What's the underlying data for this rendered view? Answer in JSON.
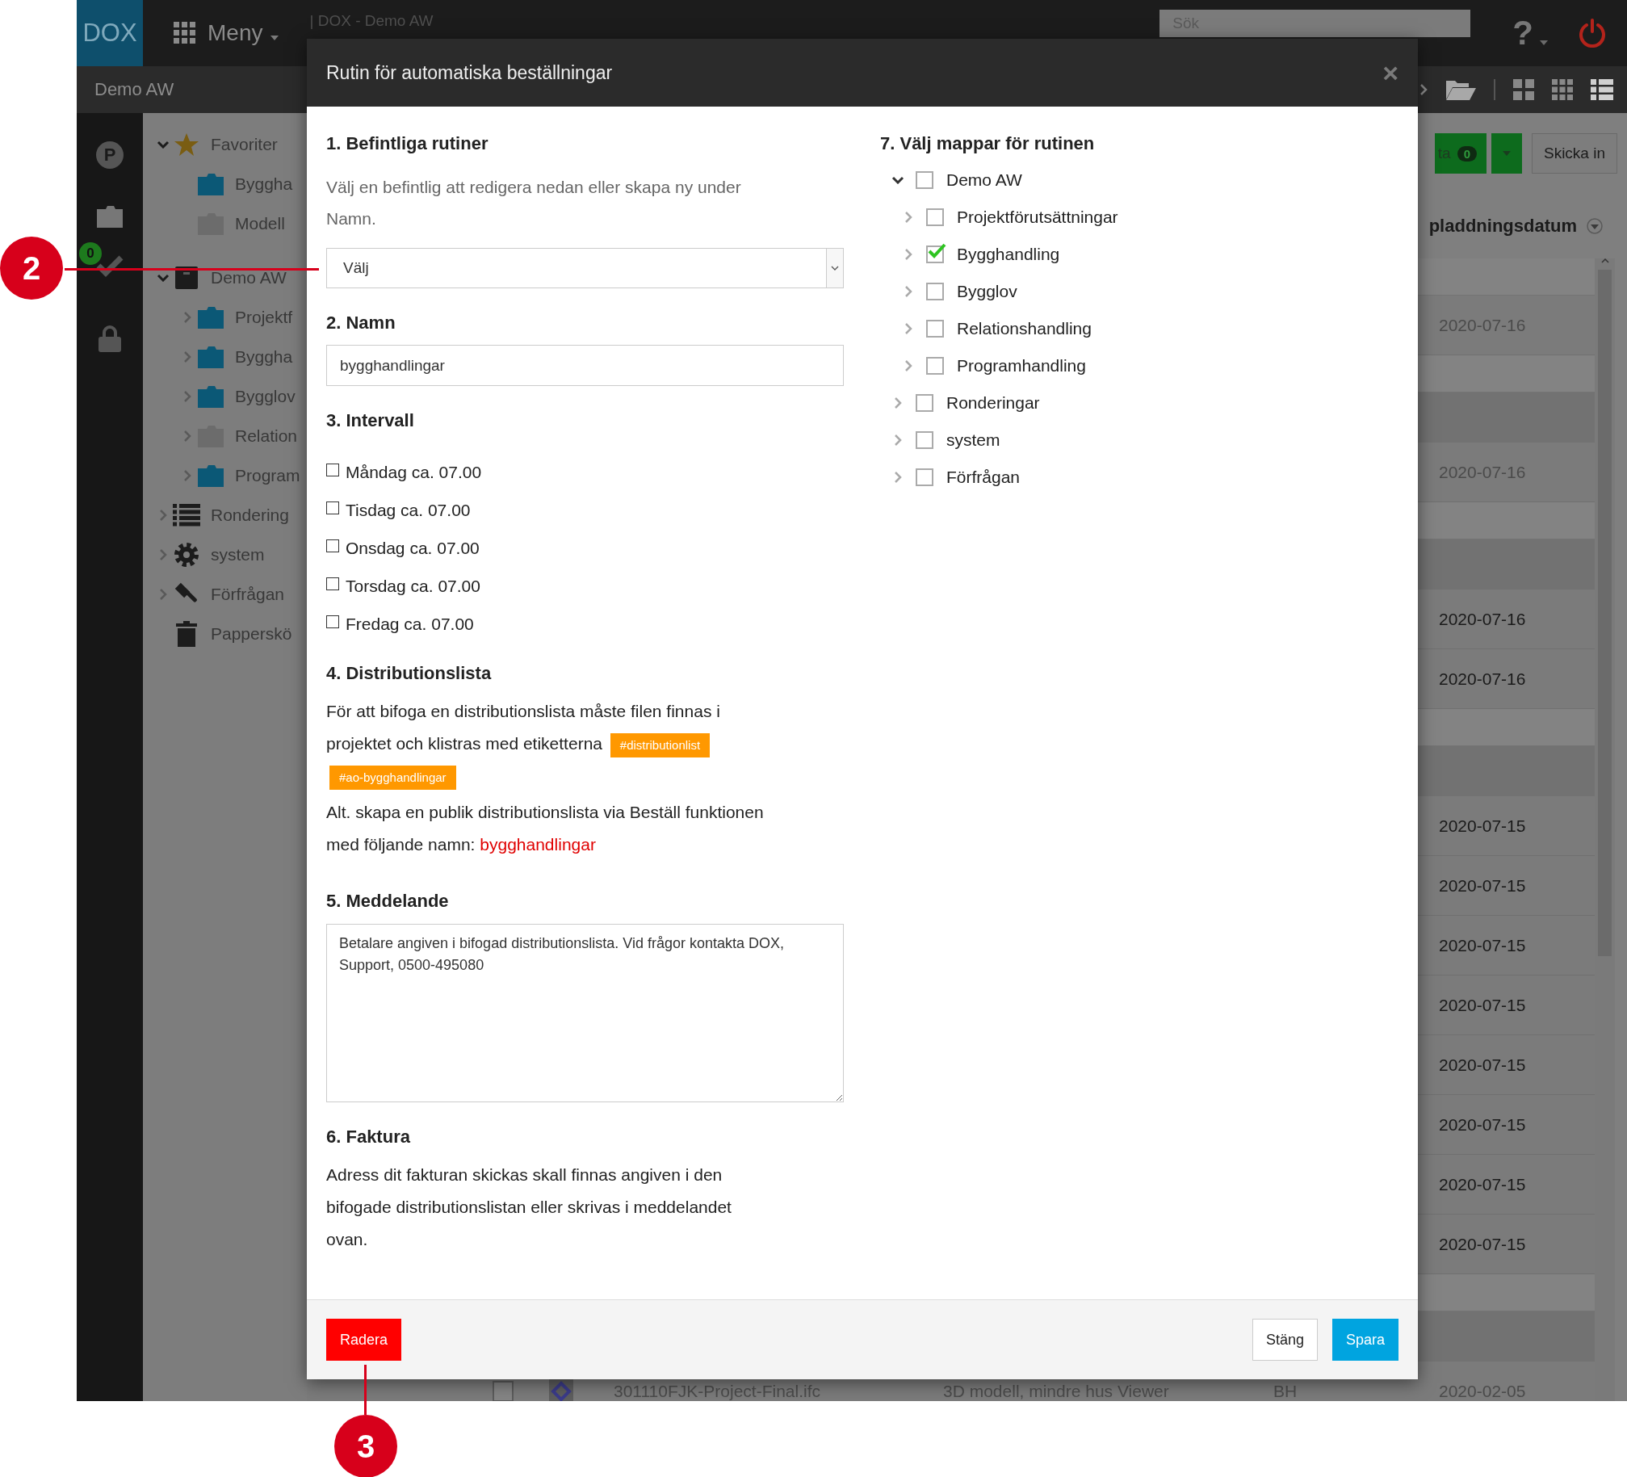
{
  "topbar": {
    "logo": "DOX",
    "menu": "Meny",
    "breadcrumb": "| DOX - Demo AW",
    "search": {
      "placeholder": "Sök"
    },
    "help": "?"
  },
  "subbar": {
    "title": "Demo AW"
  },
  "rail": {
    "items": [
      {
        "kind": "parking",
        "label": "P"
      },
      {
        "kind": "folder"
      },
      {
        "kind": "tasks",
        "badge": "0"
      },
      {
        "kind": "lock"
      }
    ]
  },
  "sidebar": {
    "items": [
      {
        "kind": "favorites",
        "label": "Favoriter",
        "expanded": true,
        "children": [
          {
            "kind": "folder",
            "label": "Byggha"
          },
          {
            "kind": "empty-folder",
            "label": "Modell"
          }
        ]
      },
      {
        "kind": "project",
        "label": "Demo AW",
        "expanded": true,
        "children": [
          {
            "kind": "folder",
            "label": "Projektf",
            "expanded": false
          },
          {
            "kind": "folder",
            "label": "Byggha",
            "expanded": false
          },
          {
            "kind": "folder",
            "label": "Bygglov",
            "expanded": false
          },
          {
            "kind": "empty-folder",
            "label": "Relation",
            "expanded": false
          },
          {
            "kind": "folder",
            "label": "Program",
            "expanded": false
          }
        ]
      },
      {
        "kind": "list",
        "label": "Rondering",
        "expanded": false
      },
      {
        "kind": "gear",
        "label": "system",
        "expanded": false
      },
      {
        "kind": "gavel",
        "label": "Förfrågan",
        "expanded": false
      },
      {
        "kind": "trash",
        "label": "Papperskö"
      }
    ]
  },
  "toolbar": {
    "send_label": "ta",
    "send_count": "0",
    "submit": "Skicka in"
  },
  "table": {
    "column_header": "pladdningsdatum",
    "rows": [
      {
        "kind": "blank"
      },
      {
        "kind": "file",
        "date": "2020-07-16",
        "muted": true
      },
      {
        "kind": "blank"
      },
      {
        "kind": "group"
      },
      {
        "kind": "file",
        "date": "2020-07-16",
        "muted": true
      },
      {
        "kind": "blank"
      },
      {
        "kind": "group"
      },
      {
        "kind": "file",
        "date": "2020-07-16",
        "muted": false
      },
      {
        "kind": "file",
        "date": "2020-07-16",
        "muted": false
      },
      {
        "kind": "blank"
      },
      {
        "kind": "group"
      },
      {
        "kind": "file",
        "date": "2020-07-15",
        "muted": false
      },
      {
        "kind": "file",
        "date": "2020-07-15",
        "muted": false
      },
      {
        "kind": "file",
        "date": "2020-07-15",
        "muted": false
      },
      {
        "kind": "file",
        "date": "2020-07-15",
        "muted": false
      },
      {
        "kind": "file",
        "date": "2020-07-15",
        "muted": false
      },
      {
        "kind": "file",
        "date": "2020-07-15",
        "muted": false
      },
      {
        "kind": "file",
        "date": "2020-07-15",
        "muted": false
      },
      {
        "kind": "file",
        "date": "2020-07-15",
        "muted": false
      },
      {
        "kind": "blank"
      },
      {
        "kind": "group"
      },
      {
        "kind": "file",
        "checked": false,
        "name": "301110FJK-Project-Final.ifc",
        "description": "3D modell, mindre hus Viewer",
        "by": "BH",
        "date": "2020-02-05",
        "muted": true
      }
    ]
  },
  "dialog": {
    "title": "Rutin för automatiska beställningar",
    "close": "×",
    "existing": {
      "heading": "1. Befintliga rutiner",
      "hint": "Välj en befintlig att redigera nedan eller skapa ny under Namn.",
      "select": "Välj"
    },
    "name": {
      "heading": "2. Namn",
      "value": "bygghandlingar"
    },
    "interval": {
      "heading": "3. Intervall",
      "days": [
        {
          "label": "Måndag ca. 07.00",
          "checked": false
        },
        {
          "label": "Tisdag ca. 07.00",
          "checked": false
        },
        {
          "label": "Onsdag ca. 07.00",
          "checked": false
        },
        {
          "label": "Torsdag ca. 07.00",
          "checked": false
        },
        {
          "label": "Fredag ca. 07.00",
          "checked": false
        }
      ]
    },
    "distribution": {
      "heading": "4. Distributionslista",
      "text": "För att bifoga en distributionslista måste filen finnas i projektet och klistras med etiketterna",
      "tags": [
        "#distributionlist",
        "#ao-bygghandlingar"
      ],
      "alt_text": "Alt. skapa en publik distributionslista via Beställ funktionen med följande namn:",
      "list_name": "bygghandlingar"
    },
    "message": {
      "heading": "5. Meddelande",
      "value": "Betalare angiven i bifogad distributionslista. Vid frågor kontakta DOX, Support, 0500-495080"
    },
    "invoice": {
      "heading": "6. Faktura",
      "text": "Adress dit fakturan skickas skall finnas angiven i den bifogade distributionslistan eller skrivas i meddelandet ovan."
    },
    "folders": {
      "heading": "7. Välj mappar för rutinen",
      "items": [
        {
          "label": "Demo AW",
          "checked": false,
          "expanded": true,
          "children": [
            {
              "label": "Projektförutsättningar",
              "checked": false,
              "expanded": false
            },
            {
              "label": "Bygghandling",
              "checked": true,
              "expanded": false
            },
            {
              "label": "Bygglov",
              "checked": false,
              "expanded": false
            },
            {
              "label": "Relationshandling",
              "checked": false,
              "expanded": false
            },
            {
              "label": "Programhandling",
              "checked": false,
              "expanded": false
            }
          ]
        },
        {
          "label": "Ronderingar",
          "checked": false,
          "expanded": false
        },
        {
          "label": "system",
          "checked": false,
          "expanded": false
        },
        {
          "label": "Förfrågan",
          "checked": false,
          "expanded": false
        }
      ]
    },
    "buttons": [
      {
        "label": "Radera",
        "kind": "danger"
      },
      {
        "label": "Stäng",
        "kind": "default"
      },
      {
        "label": "Spara",
        "kind": "primary"
      }
    ]
  },
  "callouts": [
    {
      "label": "2"
    },
    {
      "label": "3"
    }
  ]
}
